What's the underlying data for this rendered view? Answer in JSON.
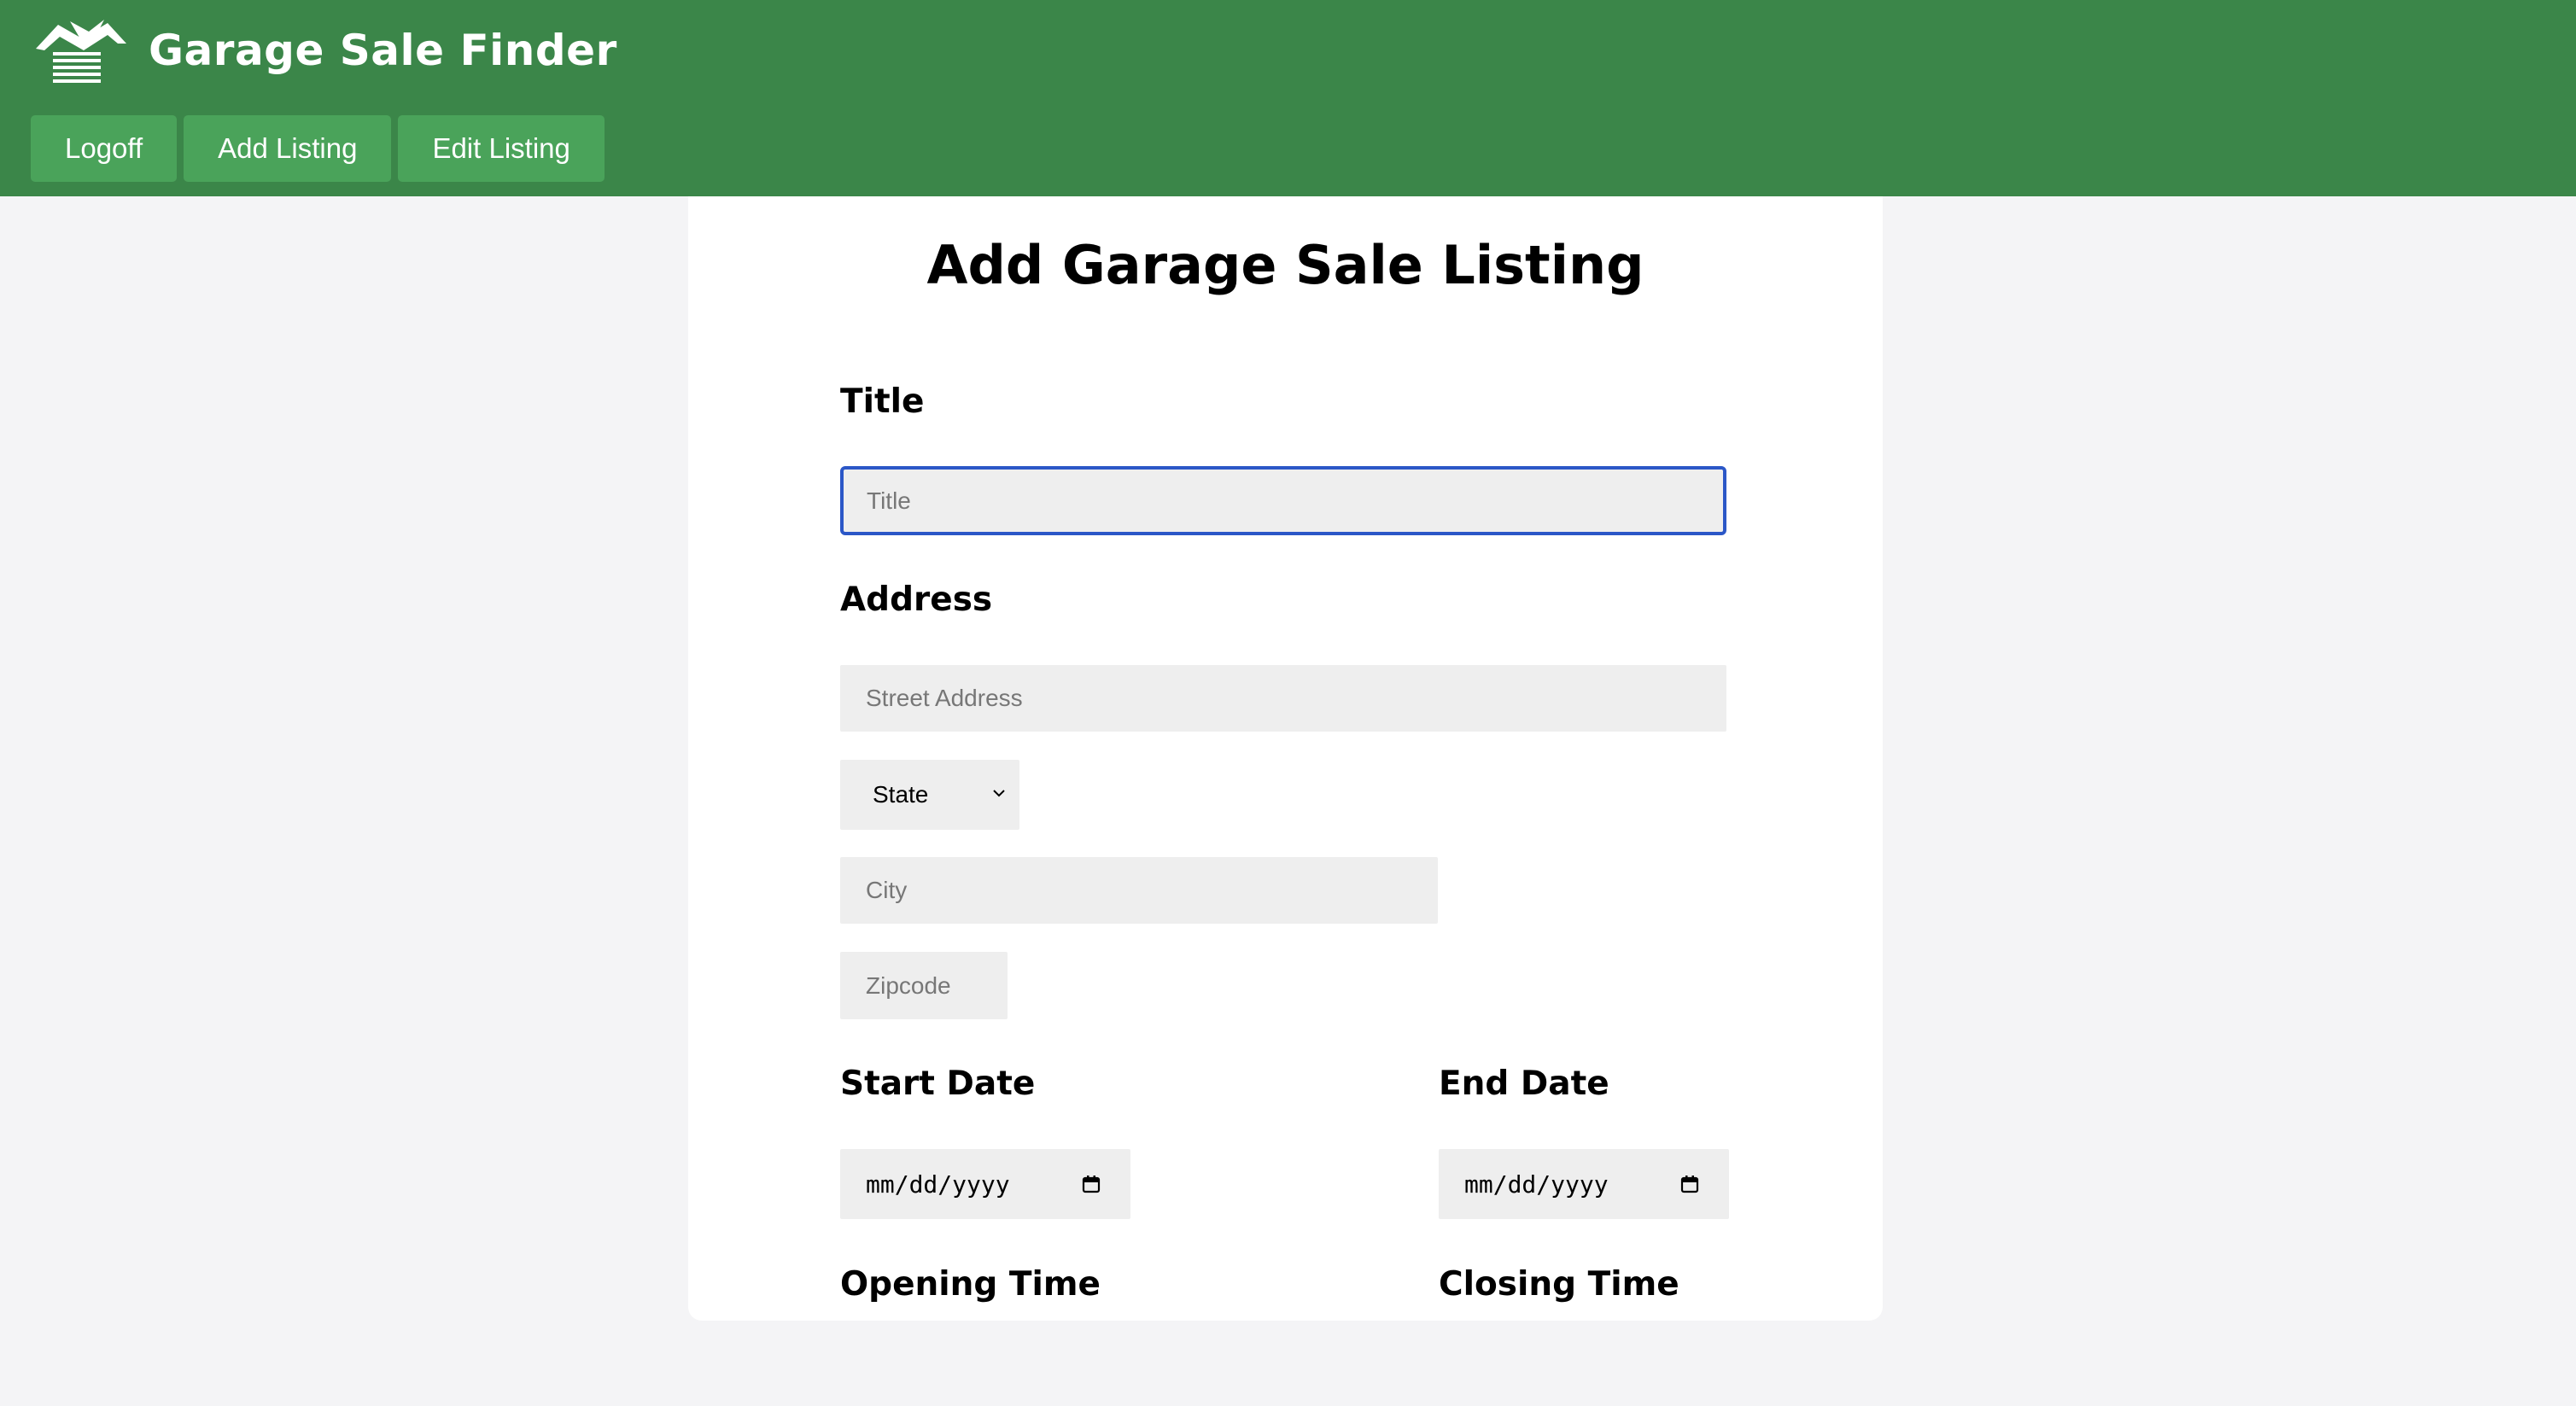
{
  "header": {
    "app_name": "Garage Sale Finder",
    "logo_icon": "garage-house-bird-icon",
    "background_color": "#3b8649",
    "nav": [
      {
        "label": "Logoff"
      },
      {
        "label": "Add Listing"
      },
      {
        "label": "Edit Listing"
      }
    ],
    "nav_button_color": "#4aa35a"
  },
  "form": {
    "page_title": "Add Garage Sale Listing",
    "title_label": "Title",
    "title_placeholder": "Title",
    "address_label": "Address",
    "street_placeholder": "Street Address",
    "state_selected": "State",
    "city_placeholder": "City",
    "zipcode_placeholder": "Zipcode",
    "start_date_label": "Start Date",
    "start_date_value": "mm/dd/yyyy",
    "end_date_label": "End Date",
    "end_date_value": "mm/dd/yyyy",
    "opening_time_label": "Opening Time",
    "closing_time_label": "Closing Time",
    "focus_color": "#2b57c7"
  }
}
